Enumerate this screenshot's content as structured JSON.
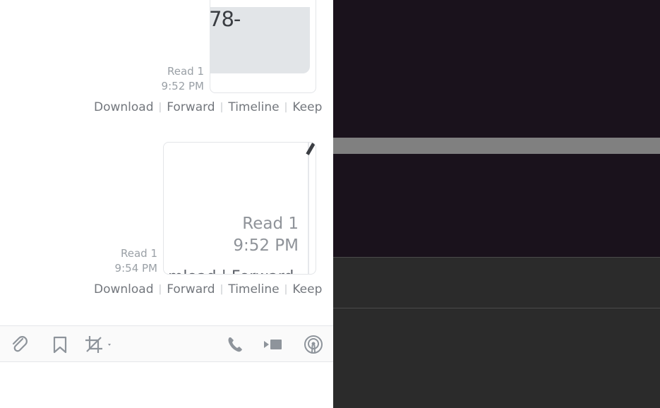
{
  "messages": [
    {
      "thumb_text": "78-",
      "read_label": "Read 1",
      "time": "9:52 PM",
      "actions": [
        "Download",
        "Forward",
        "Timeline",
        "Keep"
      ]
    },
    {
      "inner_read": "Read 1",
      "inner_time": "9:52 PM",
      "inner_links": "mload | Forward",
      "read_label": "Read 1",
      "time": "9:54 PM",
      "actions": [
        "Download",
        "Forward",
        "Timeline",
        "Keep"
      ]
    }
  ],
  "toolbar": {
    "icons": [
      "attach-icon",
      "bookmark-icon",
      "crop-icon",
      "phone-icon",
      "video-icon",
      "broadcast-icon"
    ]
  },
  "colors": {
    "dark_pane": "#1a121c",
    "scroll_bar": "#808080",
    "lower_pane": "#2b2b2b",
    "icon_color": "#8e949b"
  }
}
